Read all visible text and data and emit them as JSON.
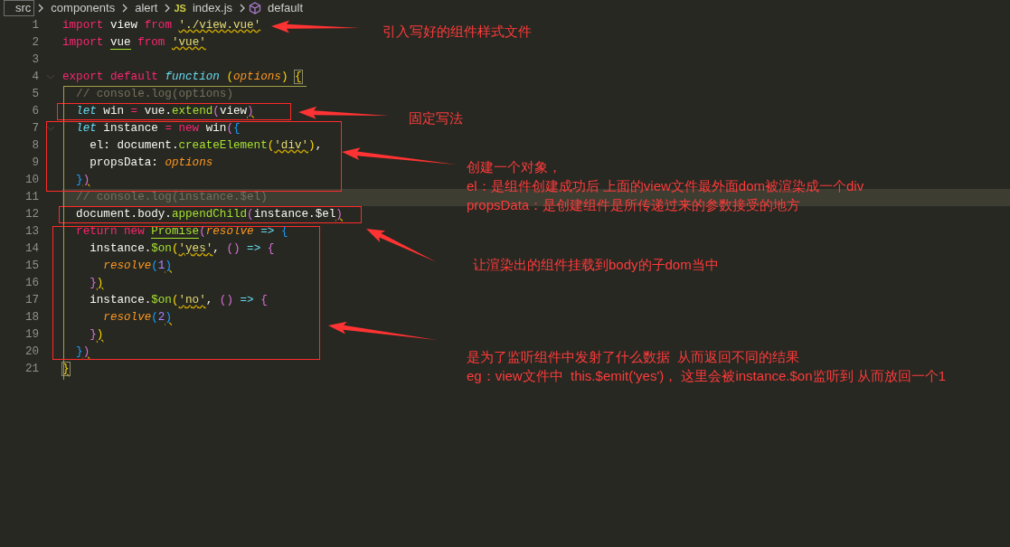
{
  "breadcrumb": [
    {
      "label": "src",
      "kind": "folder",
      "focused": true
    },
    {
      "label": "components",
      "kind": "folder",
      "focused": false
    },
    {
      "label": "alert",
      "kind": "folder",
      "focused": false
    },
    {
      "label": "index.js",
      "kind": "js-file",
      "badge": "JS",
      "focused": false
    },
    {
      "label": "default",
      "kind": "symbol",
      "focused": false
    }
  ],
  "lines": [
    {
      "number": "1",
      "tokens": [
        {
          "text": "import",
          "kind": "keyword"
        },
        {
          "text": " view ",
          "kind": "plain"
        },
        {
          "text": "from ",
          "kind": "keyword"
        },
        {
          "text": "'./view.vue'",
          "kind": "string",
          "warn": true
        }
      ]
    },
    {
      "number": "2",
      "tokens": [
        {
          "text": "import ",
          "kind": "keyword"
        },
        {
          "text": "vue",
          "kind": "plain",
          "marked": true
        },
        {
          "text": " from ",
          "kind": "keyword"
        },
        {
          "text": "'vue'",
          "kind": "string",
          "warn": true
        }
      ]
    },
    {
      "number": "3"
    },
    {
      "number": "4",
      "foldable": true,
      "tokens": [
        {
          "text": "export default ",
          "kind": "keyword"
        },
        {
          "text": "function ",
          "kind": "storage"
        },
        {
          "text": "(",
          "kind": "brace1"
        },
        {
          "text": "options",
          "kind": "param"
        },
        {
          "text": ") ",
          "kind": "brace1"
        },
        {
          "text": "{",
          "kind": "brace1",
          "matched": true
        }
      ]
    },
    {
      "number": "5",
      "tokens": [
        {
          "text": "  // console.log(options)",
          "kind": "comment"
        }
      ]
    },
    {
      "number": "6",
      "tokens": [
        {
          "text": "  let",
          "kind": "storage"
        },
        {
          "text": " win ",
          "kind": "plain"
        },
        {
          "text": "=",
          "kind": "keyword"
        },
        {
          "text": " vue.",
          "kind": "plain"
        },
        {
          "text": "extend",
          "kind": "function"
        },
        {
          "text": "(",
          "kind": "brace2"
        },
        {
          "text": "view",
          "kind": "plain"
        },
        {
          "text": ")",
          "kind": "brace2",
          "warn": true
        }
      ]
    },
    {
      "number": "7",
      "foldable": true,
      "tokens": [
        {
          "text": "  let",
          "kind": "storage"
        },
        {
          "text": " instance ",
          "kind": "plain"
        },
        {
          "text": "= new",
          "kind": "keyword"
        },
        {
          "text": " win",
          "kind": "plain"
        },
        {
          "text": "(",
          "kind": "brace2"
        },
        {
          "text": "{",
          "kind": "brace3"
        }
      ]
    },
    {
      "number": "8",
      "tokens": [
        {
          "text": "    el: document.",
          "kind": "plain"
        },
        {
          "text": "createElement",
          "kind": "function"
        },
        {
          "text": "(",
          "kind": "brace1"
        },
        {
          "text": "'div'",
          "kind": "string",
          "warn": true
        },
        {
          "text": ")",
          "kind": "brace1"
        },
        {
          "text": ",",
          "kind": "plain"
        }
      ]
    },
    {
      "number": "9",
      "tokens": [
        {
          "text": "    propsData: ",
          "kind": "plain"
        },
        {
          "text": "options",
          "kind": "param"
        }
      ]
    },
    {
      "number": "10",
      "tokens": [
        {
          "text": "  }",
          "kind": "brace3"
        },
        {
          "text": ")",
          "kind": "brace2",
          "warn": true
        }
      ]
    },
    {
      "number": "11",
      "current": true,
      "tokens": [
        {
          "text": "  // console.log(instance.$el)",
          "kind": "comment"
        }
      ]
    },
    {
      "number": "12",
      "tokens": [
        {
          "text": "  document.body.",
          "kind": "plain"
        },
        {
          "text": "appendChild",
          "kind": "function"
        },
        {
          "text": "(",
          "kind": "brace2"
        },
        {
          "text": "instance.$el",
          "kind": "plain"
        },
        {
          "text": ")",
          "kind": "brace2",
          "warn": true
        }
      ]
    },
    {
      "number": "13",
      "tokens": [
        {
          "text": "  return new ",
          "kind": "keyword"
        },
        {
          "text": "Promise",
          "kind": "function",
          "marked": true
        },
        {
          "text": "(",
          "kind": "brace2"
        },
        {
          "text": "resolve ",
          "kind": "param"
        },
        {
          "text": "=> ",
          "kind": "storage"
        },
        {
          "text": "{",
          "kind": "brace3"
        }
      ]
    },
    {
      "number": "14",
      "tokens": [
        {
          "text": "    instance.",
          "kind": "plain"
        },
        {
          "text": "$on",
          "kind": "function"
        },
        {
          "text": "(",
          "kind": "brace1"
        },
        {
          "text": "'yes'",
          "kind": "string",
          "warn": true
        },
        {
          "text": ", ",
          "kind": "plain"
        },
        {
          "text": "() ",
          "kind": "brace2"
        },
        {
          "text": "=> ",
          "kind": "storage"
        },
        {
          "text": "{",
          "kind": "brace2"
        }
      ]
    },
    {
      "number": "15",
      "tokens": [
        {
          "text": "      resolve",
          "kind": "param"
        },
        {
          "text": "(",
          "kind": "brace3"
        },
        {
          "text": "1",
          "kind": "number"
        },
        {
          "text": ")",
          "kind": "brace3",
          "warn": true
        }
      ]
    },
    {
      "number": "16",
      "tokens": [
        {
          "text": "    }",
          "kind": "brace2"
        },
        {
          "text": ")",
          "kind": "brace1",
          "warn": true
        }
      ]
    },
    {
      "number": "17",
      "tokens": [
        {
          "text": "    instance.",
          "kind": "plain"
        },
        {
          "text": "$on",
          "kind": "function"
        },
        {
          "text": "(",
          "kind": "brace1"
        },
        {
          "text": "'no'",
          "kind": "string",
          "warn": true
        },
        {
          "text": ", ",
          "kind": "plain"
        },
        {
          "text": "() ",
          "kind": "brace2"
        },
        {
          "text": "=> ",
          "kind": "storage"
        },
        {
          "text": "{",
          "kind": "brace2"
        }
      ]
    },
    {
      "number": "18",
      "tokens": [
        {
          "text": "      resolve",
          "kind": "param"
        },
        {
          "text": "(",
          "kind": "brace3"
        },
        {
          "text": "2",
          "kind": "number"
        },
        {
          "text": ")",
          "kind": "brace3",
          "warn": true
        }
      ]
    },
    {
      "number": "19",
      "tokens": [
        {
          "text": "    }",
          "kind": "brace2"
        },
        {
          "text": ")",
          "kind": "brace1",
          "warn": true
        }
      ]
    },
    {
      "number": "20",
      "tokens": [
        {
          "text": "  }",
          "kind": "brace3"
        },
        {
          "text": ")",
          "kind": "brace2",
          "warn": true
        }
      ]
    },
    {
      "number": "21",
      "tokens": [
        {
          "text": "}",
          "kind": "brace1",
          "matched": true,
          "warn": true
        }
      ]
    }
  ],
  "annotations": [
    {
      "lines": [
        "引入写好的组件样式文件"
      ]
    },
    {
      "lines": [
        "固定写法"
      ]
    },
    {
      "lines": [
        "创建一个对象，",
        "el：是组件创建成功后 上面的view文件最外面dom被渲染成一个div",
        "propsData：是创建组件是所传递过来的参数接受的地方"
      ]
    },
    {
      "lines": [
        "让渲染出的组件挂载到body的子dom当中"
      ]
    },
    {
      "lines": [
        "是为了监听组件中发射了什么数据  从而返回不同的结果",
        "eg：view文件中  this.$emit('yes')， 这里会被instance.$on监听到 从而放回一个1"
      ]
    }
  ]
}
